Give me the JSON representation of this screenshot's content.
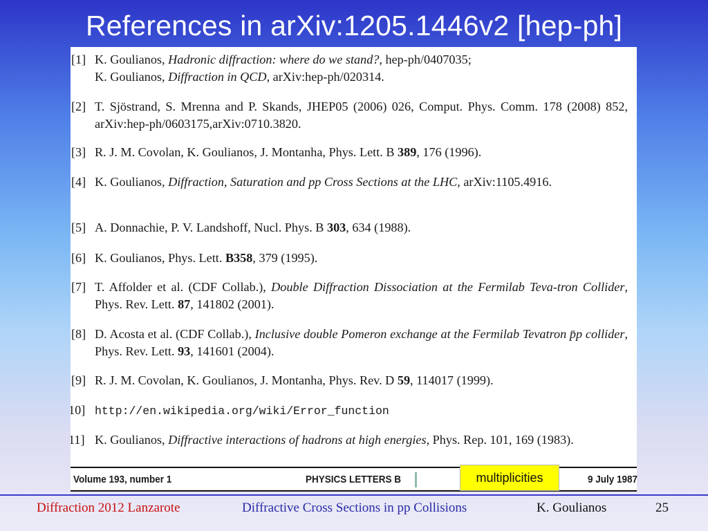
{
  "slide": {
    "title": "References in arXiv:1205.1446v2 [hep-ph]"
  },
  "references": [
    {
      "num": "[1]",
      "parts": [
        {
          "t": "K. Goulianos, "
        },
        {
          "t": "Hadronic diffraction: where do we stand?",
          "s": "i"
        },
        {
          "t": ", hep-ph/0407035;"
        },
        {
          "br": true
        },
        {
          "t": "K. Goulianos, "
        },
        {
          "t": "Diffraction in QCD",
          "s": "i"
        },
        {
          "t": ", arXiv:hep-ph/020314."
        }
      ]
    },
    {
      "num": "[2]",
      "parts": [
        {
          "t": "T. Sjöstrand, S. Mrenna and P. Skands, JHEP05 (2006) 026, Comput. Phys. Comm. 178 (2008) 852, arXiv:hep-ph/0603175,arXiv:0710.3820."
        }
      ]
    },
    {
      "num": "[3]",
      "parts": [
        {
          "t": "R. J. M. Covolan, K. Goulianos, J. Montanha, Phys. Lett. B "
        },
        {
          "t": "389",
          "s": "b"
        },
        {
          "t": ", 176 (1996)."
        }
      ]
    },
    {
      "num": "[4]",
      "parts": [
        {
          "t": "K. Goulianos, "
        },
        {
          "t": "Diffraction, Saturation and pp Cross Sections at the LHC",
          "s": "i"
        },
        {
          "t": ", arXiv:1105.4916."
        }
      ]
    },
    {
      "num": "[5]",
      "parts": [
        {
          "t": "A. Donnachie, P. V. Landshoff, Nucl. Phys. B "
        },
        {
          "t": "303",
          "s": "b"
        },
        {
          "t": ", 634 (1988)."
        }
      ]
    },
    {
      "num": "[6]",
      "parts": [
        {
          "t": "K. Goulianos, Phys. Lett. "
        },
        {
          "t": "B358",
          "s": "b"
        },
        {
          "t": ", 379 (1995)."
        }
      ]
    },
    {
      "num": "[7]",
      "parts": [
        {
          "t": "T. Affolder et al. (CDF Collab.), "
        },
        {
          "t": "Double Diffraction Dissociation at the Fermilab Teva-tron Collider",
          "s": "i"
        },
        {
          "t": ", Phys. Rev. Lett. "
        },
        {
          "t": "87",
          "s": "b"
        },
        {
          "t": ", 141802 (2001)."
        }
      ]
    },
    {
      "num": "[8]",
      "parts": [
        {
          "t": "D. Acosta et al. (CDF Collab.), "
        },
        {
          "t": "Inclusive double Pomeron exchange at the Fermilab Tevatron p̄p collider",
          "s": "i"
        },
        {
          "t": ", Phys. Rev. Lett. "
        },
        {
          "t": "93",
          "s": "b"
        },
        {
          "t": ", 141601 (2004)."
        }
      ]
    },
    {
      "num": "[9]",
      "parts": [
        {
          "t": "R. J. M. Covolan, K. Goulianos, J. Montanha, Phys. Rev. D "
        },
        {
          "t": "59",
          "s": "b"
        },
        {
          "t": ", 114017 (1999)."
        }
      ]
    },
    {
      "num": "10]",
      "parts": [
        {
          "t": "http://en.wikipedia.org/wiki/Error_function",
          "s": "m"
        }
      ]
    },
    {
      "num": "11]",
      "parts": [
        {
          "t": "K. Goulianos, "
        },
        {
          "t": "Diffractive interactions of hadrons at high energies",
          "s": "i"
        },
        {
          "t": ", Phys. Rep. 101, 169 (1983)."
        }
      ]
    }
  ],
  "journal_strip": {
    "volume": "Volume 193, number 1",
    "journal": "PHYSICS LETTERS B",
    "date": "9 July 1987"
  },
  "badge": {
    "label": "multiplicities",
    "color": "#ffff00"
  },
  "footer": {
    "left": "Diffraction 2012 Lanzarote",
    "center": "Diffractive Cross Sections in pp Collisions",
    "author": "K. Goulianos",
    "page": "25"
  },
  "colors": {
    "footer_left": "#c81010",
    "footer_center": "#2a2aa8",
    "background_top": "#2d35c8"
  }
}
